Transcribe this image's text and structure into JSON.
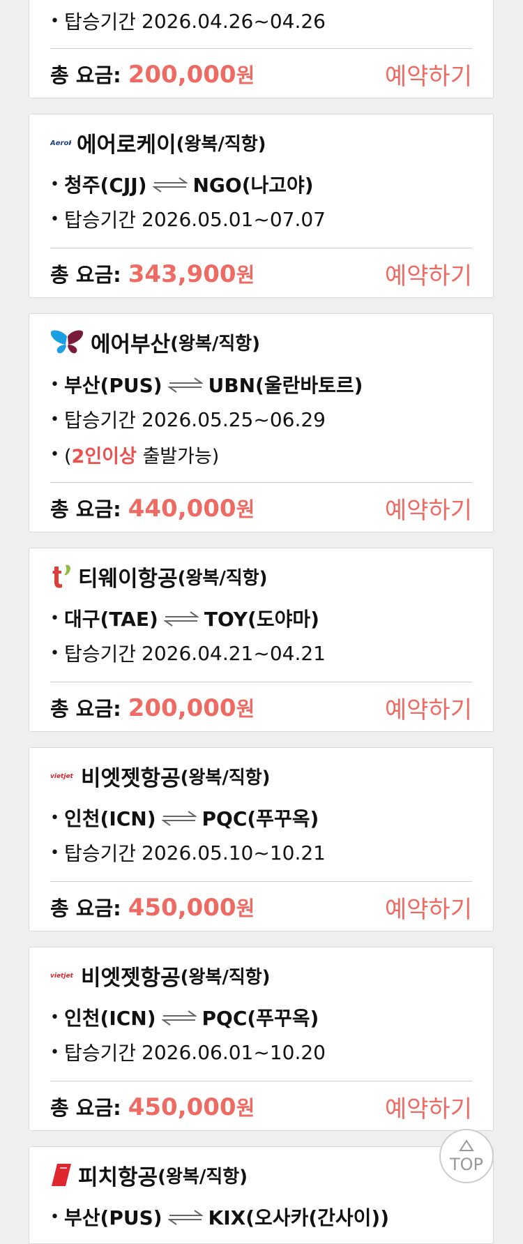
{
  "colors": {
    "accent": "#ee6b63",
    "background": "#efefef",
    "card_border": "#d9d9d9"
  },
  "cards": [
    {
      "period_label": "탑승기간",
      "period": "2026.04.26~04.26",
      "price_label": "총 요금:",
      "price": "200,000",
      "price_unit": "원",
      "book_label": "예약하기"
    },
    {
      "logo": "aerok-logo",
      "logo_text": "AeroK",
      "airline": "에어로케이",
      "trip_type": "(왕복/직항)",
      "origin": "청주(CJJ)",
      "destination": "NGO(나고야)",
      "period_label": "탑승기간",
      "period": "2026.05.01~07.07",
      "price_label": "총 요금:",
      "price": "343,900",
      "price_unit": "원",
      "book_label": "예약하기"
    },
    {
      "logo": "airbusan-logo",
      "airline": "에어부산",
      "trip_type": "(왕복/직항)",
      "origin": "부산(PUS)",
      "destination": "UBN(울란바토르)",
      "period_label": "탑승기간",
      "period": "2026.05.25~06.29",
      "note_prefix": "(",
      "note_highlight": "2인이상",
      "note_rest": " 출발가능)",
      "price_label": "총 요금:",
      "price": "440,000",
      "price_unit": "원",
      "book_label": "예약하기"
    },
    {
      "logo": "tway-logo",
      "airline": "티웨이항공",
      "trip_type": "(왕복/직항)",
      "origin": "대구(TAE)",
      "destination": "TOY(도야마)",
      "period_label": "탑승기간",
      "period": "2026.04.21~04.21",
      "price_label": "총 요금:",
      "price": "200,000",
      "price_unit": "원",
      "book_label": "예약하기"
    },
    {
      "logo": "vietjet-logo",
      "logo_text": "vietjet",
      "airline": "비엣젯항공",
      "trip_type": "(왕복/직항)",
      "origin": "인천(ICN)",
      "destination": "PQC(푸꾸옥)",
      "period_label": "탑승기간",
      "period": "2026.05.10~10.21",
      "price_label": "총 요금:",
      "price": "450,000",
      "price_unit": "원",
      "book_label": "예약하기"
    },
    {
      "logo": "vietjet-logo",
      "logo_text": "vietjet",
      "airline": "비엣젯항공",
      "trip_type": "(왕복/직항)",
      "origin": "인천(ICN)",
      "destination": "PQC(푸꾸옥)",
      "period_label": "탑승기간",
      "period": "2026.06.01~10.20",
      "price_label": "총 요금:",
      "price": "450,000",
      "price_unit": "원",
      "book_label": "예약하기"
    },
    {
      "logo": "peach-logo",
      "airline": "피치항공",
      "trip_type": "(왕복/직항)",
      "origin": "부산(PUS)",
      "destination": "KIX(오사카(간사이))"
    }
  ],
  "top_button": {
    "label": "TOP",
    "icon": "up-triangle-icon"
  }
}
